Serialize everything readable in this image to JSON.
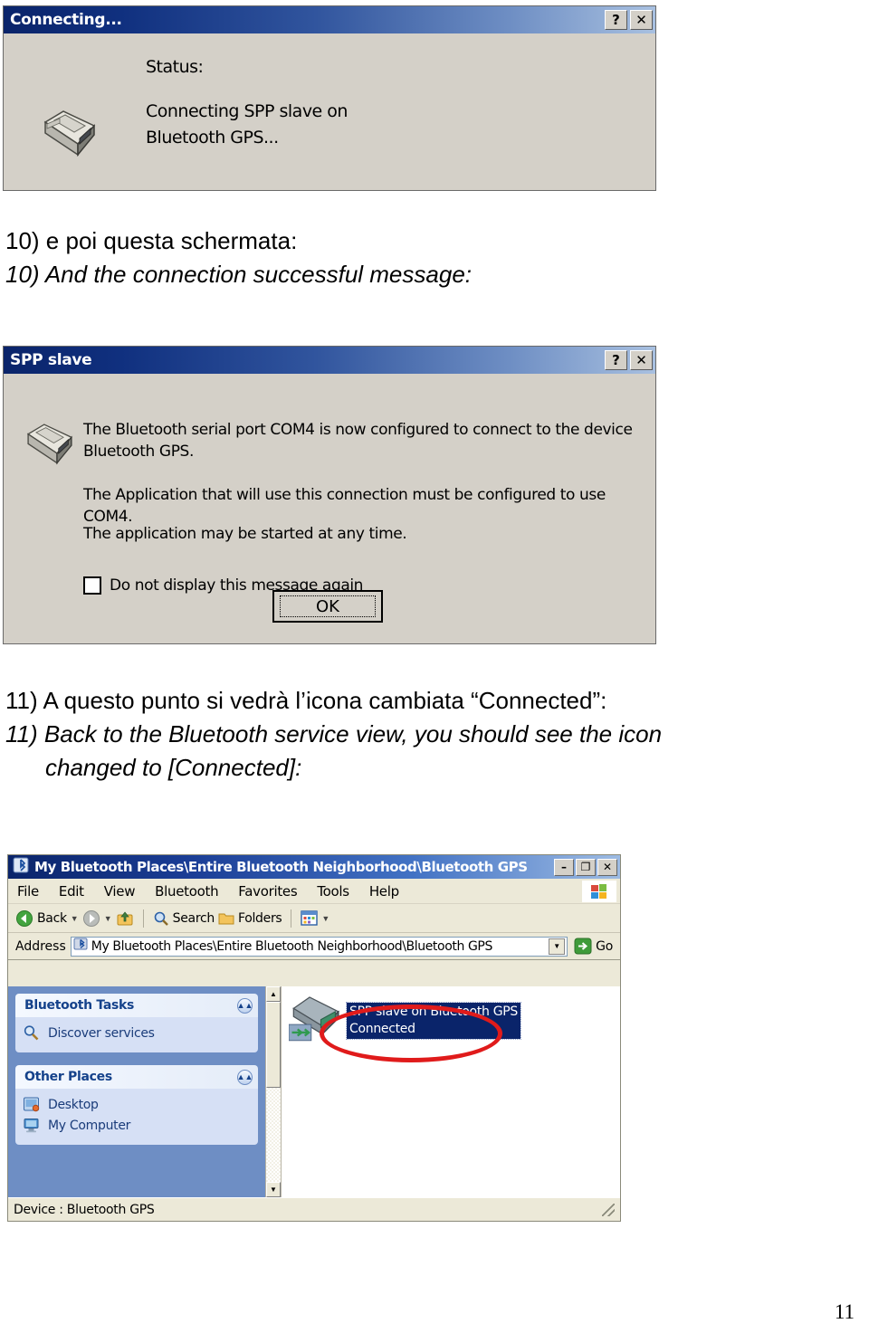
{
  "dialog_connecting": {
    "title": "Connecting...",
    "help_btn": "?",
    "close_btn": "✕",
    "status_label": "Status:",
    "status_line1": "Connecting SPP slave on",
    "status_line2": "Bluetooth GPS...",
    "icon": "serial-port-icon"
  },
  "caption_10": {
    "line_it": "10) e poi questa schermata:",
    "line_en": "10) And the connection successful message:"
  },
  "dialog_spp": {
    "title": "SPP slave",
    "help_btn": "?",
    "close_btn": "✕",
    "paragraph1": "The Bluetooth serial port COM4 is now configured to connect to the device Bluetooth GPS.",
    "paragraph2": "The Application that will use this connection must be configured to use COM4.",
    "paragraph3": "The application may be started at any time.",
    "checkbox_label": "Do not display this message again",
    "checkbox_checked": false,
    "ok_label": "OK",
    "icon": "serial-port-icon"
  },
  "caption_11": {
    "line_it": "11) A questo punto si vedrà l’icona cambiata “Connected”:",
    "line_en_1": "11) Back to the Bluetooth service view, you should see the icon",
    "line_en_2": "changed to [Connected]:"
  },
  "explorer": {
    "title": "My Bluetooth Places\\Entire Bluetooth Neighborhood\\Bluetooth GPS",
    "minimize_btn": "–",
    "maximize_btn": "❐",
    "close_btn": "✕",
    "menu": [
      {
        "label": "File",
        "accel": "F"
      },
      {
        "label": "Edit",
        "accel": "E"
      },
      {
        "label": "View",
        "accel": "V"
      },
      {
        "label": "Bluetooth",
        "accel": "B"
      },
      {
        "label": "Favorites",
        "accel": "a"
      },
      {
        "label": "Tools",
        "accel": "T"
      },
      {
        "label": "Help",
        "accel": "H"
      }
    ],
    "toolbar": {
      "back_label": "Back",
      "search_label": "Search",
      "folders_label": "Folders"
    },
    "address": {
      "label": "Address",
      "value": "My Bluetooth Places\\Entire Bluetooth Neighborhood\\Bluetooth GPS",
      "go_label": "Go"
    },
    "sidebar": {
      "panels": [
        {
          "title": "Bluetooth Tasks",
          "items": [
            {
              "label": "Discover services",
              "icon": "magnifier-icon"
            }
          ]
        },
        {
          "title": "Other Places",
          "items": [
            {
              "label": "Desktop",
              "icon": "desktop-icon"
            },
            {
              "label": "My Computer",
              "icon": "my-computer-icon"
            }
          ]
        }
      ]
    },
    "content": {
      "item_line1": "SPP slave on Bluetooth GPS",
      "item_line2": "Connected",
      "item_icon": "serial-port-connected-icon",
      "annotation": "red-ellipse-highlight"
    },
    "statusbar": {
      "text": "Device : Bluetooth GPS"
    }
  },
  "page": {
    "number": "11"
  },
  "colors": {
    "titlebar_start": "#0a246a",
    "titlebar_end": "#a8c0e0",
    "dialog_face": "#d4d0c8",
    "sidebar_bg": "#6e8ec4",
    "panel_body": "#d6e0f5",
    "panel_title": "#15428b",
    "selection": "#0a246a",
    "annotation_red": "#e01b1b"
  }
}
